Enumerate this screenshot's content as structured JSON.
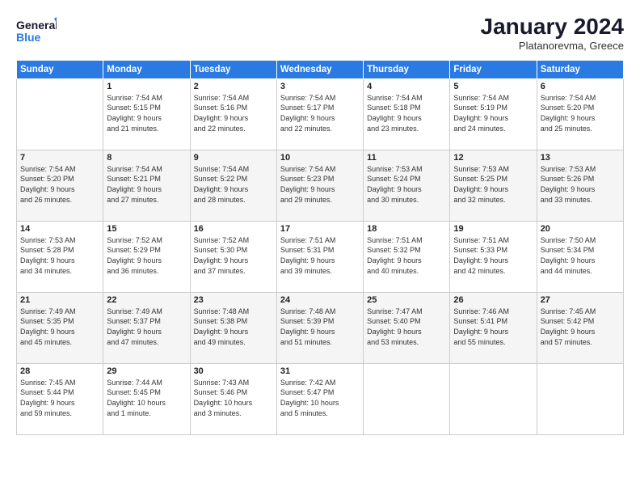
{
  "header": {
    "logo_general": "General",
    "logo_blue": "Blue",
    "month": "January 2024",
    "location": "Platanorevma, Greece"
  },
  "days_of_week": [
    "Sunday",
    "Monday",
    "Tuesday",
    "Wednesday",
    "Thursday",
    "Friday",
    "Saturday"
  ],
  "weeks": [
    [
      {
        "day": "",
        "info": ""
      },
      {
        "day": "1",
        "info": "Sunrise: 7:54 AM\nSunset: 5:15 PM\nDaylight: 9 hours\nand 21 minutes."
      },
      {
        "day": "2",
        "info": "Sunrise: 7:54 AM\nSunset: 5:16 PM\nDaylight: 9 hours\nand 22 minutes."
      },
      {
        "day": "3",
        "info": "Sunrise: 7:54 AM\nSunset: 5:17 PM\nDaylight: 9 hours\nand 22 minutes."
      },
      {
        "day": "4",
        "info": "Sunrise: 7:54 AM\nSunset: 5:18 PM\nDaylight: 9 hours\nand 23 minutes."
      },
      {
        "day": "5",
        "info": "Sunrise: 7:54 AM\nSunset: 5:19 PM\nDaylight: 9 hours\nand 24 minutes."
      },
      {
        "day": "6",
        "info": "Sunrise: 7:54 AM\nSunset: 5:20 PM\nDaylight: 9 hours\nand 25 minutes."
      }
    ],
    [
      {
        "day": "7",
        "info": "Sunrise: 7:54 AM\nSunset: 5:20 PM\nDaylight: 9 hours\nand 26 minutes."
      },
      {
        "day": "8",
        "info": "Sunrise: 7:54 AM\nSunset: 5:21 PM\nDaylight: 9 hours\nand 27 minutes."
      },
      {
        "day": "9",
        "info": "Sunrise: 7:54 AM\nSunset: 5:22 PM\nDaylight: 9 hours\nand 28 minutes."
      },
      {
        "day": "10",
        "info": "Sunrise: 7:54 AM\nSunset: 5:23 PM\nDaylight: 9 hours\nand 29 minutes."
      },
      {
        "day": "11",
        "info": "Sunrise: 7:53 AM\nSunset: 5:24 PM\nDaylight: 9 hours\nand 30 minutes."
      },
      {
        "day": "12",
        "info": "Sunrise: 7:53 AM\nSunset: 5:25 PM\nDaylight: 9 hours\nand 32 minutes."
      },
      {
        "day": "13",
        "info": "Sunrise: 7:53 AM\nSunset: 5:26 PM\nDaylight: 9 hours\nand 33 minutes."
      }
    ],
    [
      {
        "day": "14",
        "info": "Sunrise: 7:53 AM\nSunset: 5:28 PM\nDaylight: 9 hours\nand 34 minutes."
      },
      {
        "day": "15",
        "info": "Sunrise: 7:52 AM\nSunset: 5:29 PM\nDaylight: 9 hours\nand 36 minutes."
      },
      {
        "day": "16",
        "info": "Sunrise: 7:52 AM\nSunset: 5:30 PM\nDaylight: 9 hours\nand 37 minutes."
      },
      {
        "day": "17",
        "info": "Sunrise: 7:51 AM\nSunset: 5:31 PM\nDaylight: 9 hours\nand 39 minutes."
      },
      {
        "day": "18",
        "info": "Sunrise: 7:51 AM\nSunset: 5:32 PM\nDaylight: 9 hours\nand 40 minutes."
      },
      {
        "day": "19",
        "info": "Sunrise: 7:51 AM\nSunset: 5:33 PM\nDaylight: 9 hours\nand 42 minutes."
      },
      {
        "day": "20",
        "info": "Sunrise: 7:50 AM\nSunset: 5:34 PM\nDaylight: 9 hours\nand 44 minutes."
      }
    ],
    [
      {
        "day": "21",
        "info": "Sunrise: 7:49 AM\nSunset: 5:35 PM\nDaylight: 9 hours\nand 45 minutes."
      },
      {
        "day": "22",
        "info": "Sunrise: 7:49 AM\nSunset: 5:37 PM\nDaylight: 9 hours\nand 47 minutes."
      },
      {
        "day": "23",
        "info": "Sunrise: 7:48 AM\nSunset: 5:38 PM\nDaylight: 9 hours\nand 49 minutes."
      },
      {
        "day": "24",
        "info": "Sunrise: 7:48 AM\nSunset: 5:39 PM\nDaylight: 9 hours\nand 51 minutes."
      },
      {
        "day": "25",
        "info": "Sunrise: 7:47 AM\nSunset: 5:40 PM\nDaylight: 9 hours\nand 53 minutes."
      },
      {
        "day": "26",
        "info": "Sunrise: 7:46 AM\nSunset: 5:41 PM\nDaylight: 9 hours\nand 55 minutes."
      },
      {
        "day": "27",
        "info": "Sunrise: 7:45 AM\nSunset: 5:42 PM\nDaylight: 9 hours\nand 57 minutes."
      }
    ],
    [
      {
        "day": "28",
        "info": "Sunrise: 7:45 AM\nSunset: 5:44 PM\nDaylight: 9 hours\nand 59 minutes."
      },
      {
        "day": "29",
        "info": "Sunrise: 7:44 AM\nSunset: 5:45 PM\nDaylight: 10 hours\nand 1 minute."
      },
      {
        "day": "30",
        "info": "Sunrise: 7:43 AM\nSunset: 5:46 PM\nDaylight: 10 hours\nand 3 minutes."
      },
      {
        "day": "31",
        "info": "Sunrise: 7:42 AM\nSunset: 5:47 PM\nDaylight: 10 hours\nand 5 minutes."
      },
      {
        "day": "",
        "info": ""
      },
      {
        "day": "",
        "info": ""
      },
      {
        "day": "",
        "info": ""
      }
    ]
  ]
}
